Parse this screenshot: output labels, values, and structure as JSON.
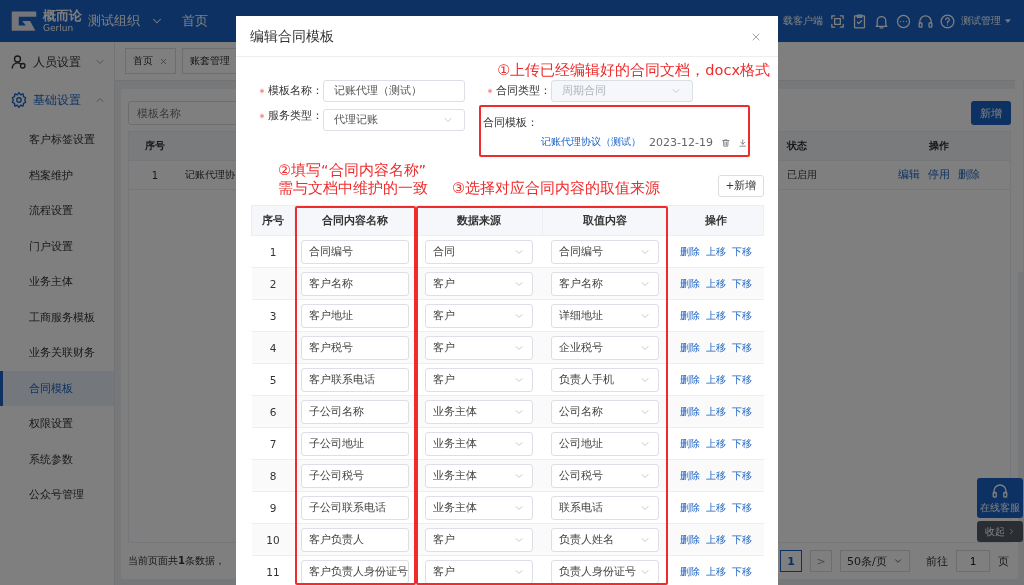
{
  "topbar": {
    "logo": {
      "name": "概而论",
      "sub": "Gerlun"
    },
    "org": "测试组织",
    "nav": [
      "首页"
    ],
    "download": "载客户端",
    "user": "测试管理"
  },
  "sidebar": [
    {
      "label": "人员设置",
      "expanded": false
    },
    {
      "label": "基础设置",
      "expanded": true,
      "children": [
        {
          "label": "客户标签设置",
          "selected": false
        },
        {
          "label": "档案维护",
          "selected": false
        },
        {
          "label": "流程设置",
          "selected": false
        },
        {
          "label": "门户设置",
          "selected": false
        },
        {
          "label": "业务主体",
          "selected": false
        },
        {
          "label": "工商服务模板",
          "selected": false
        },
        {
          "label": "业务关联财务",
          "selected": false
        },
        {
          "label": "合同模板",
          "selected": true
        },
        {
          "label": "权限设置",
          "selected": false
        },
        {
          "label": "系统参数",
          "selected": false
        },
        {
          "label": "公众号管理",
          "selected": false
        }
      ]
    }
  ],
  "tabs": [
    {
      "label": "首页",
      "closable": true
    },
    {
      "label": "账套管理",
      "closable": false
    }
  ],
  "search": {
    "placeholder": "模板名称"
  },
  "new_button": "新增",
  "table": {
    "columns": [
      "序号",
      "状态",
      "操作"
    ],
    "rows": [
      {
        "index": "1",
        "name": "记账代理协",
        "status": "已启用",
        "actions": [
          "编辑",
          "停用",
          "删除"
        ]
      }
    ]
  },
  "footer": "当前页面共**1**条数据，",
  "pagination": {
    "pages": [
      {
        "label": "1",
        "selected": true
      }
    ],
    "next": ">",
    "page_size": "50条/页",
    "goto": "前往",
    "goto_value": "1",
    "page_unit": "页"
  },
  "service": {
    "label": "在线客服",
    "collapse": "收起"
  },
  "modal": {
    "title": "编辑合同模板",
    "annotations": [
      {
        "kind": "upload",
        "text": "①上传已经编辑好的合同文档，docx格式"
      },
      {
        "kind": "name",
        "lines": [
          "②填写“合同内容名称”",
          "需与文档中维护的一致"
        ]
      },
      {
        "kind": "source",
        "text": "③选择对应合同内容的取值来源"
      }
    ],
    "fields": [
      {
        "kind": "input",
        "label": "模板名称：",
        "required": true,
        "value": "记账代理（测试）",
        "disabled": false
      },
      {
        "kind": "select",
        "label": "合同类型：",
        "required": true,
        "value": "周期合同",
        "disabled": true
      },
      {
        "kind": "select",
        "label": "服务类型：",
        "required": true,
        "value": "代理记账",
        "disabled": false
      },
      {
        "kind": "file",
        "label": "合同模板：",
        "required": false,
        "file": "记账代理协议（测试）",
        "date": "2023-12-19"
      }
    ],
    "add_button": "+新增",
    "columns": [
      "序号",
      "合同内容名称",
      "数据来源",
      "取值内容",
      "操作"
    ],
    "rows": [
      {
        "index": "1",
        "name": "合同编号",
        "source": "合同",
        "value": "合同编号",
        "actions": [
          "删除",
          "上移",
          "下移"
        ]
      },
      {
        "index": "2",
        "name": "客户名称",
        "source": "客户",
        "value": "客户名称",
        "actions": [
          "删除",
          "上移",
          "下移"
        ]
      },
      {
        "index": "3",
        "name": "客户地址",
        "source": "客户",
        "value": "详细地址",
        "actions": [
          "删除",
          "上移",
          "下移"
        ]
      },
      {
        "index": "4",
        "name": "客户税号",
        "source": "客户",
        "value": "企业税号",
        "actions": [
          "删除",
          "上移",
          "下移"
        ]
      },
      {
        "index": "5",
        "name": "客户联系电话",
        "source": "客户",
        "value": "负责人手机",
        "actions": [
          "删除",
          "上移",
          "下移"
        ]
      },
      {
        "index": "6",
        "name": "子公司名称",
        "source": "业务主体",
        "value": "公司名称",
        "actions": [
          "删除",
          "上移",
          "下移"
        ]
      },
      {
        "index": "7",
        "name": "子公司地址",
        "source": "业务主体",
        "value": "公司地址",
        "actions": [
          "删除",
          "上移",
          "下移"
        ]
      },
      {
        "index": "8",
        "name": "子公司税号",
        "source": "业务主体",
        "value": "公司税号",
        "actions": [
          "删除",
          "上移",
          "下移"
        ]
      },
      {
        "index": "9",
        "name": "子公司联系电话",
        "source": "业务主体",
        "value": "联系电话",
        "actions": [
          "删除",
          "上移",
          "下移"
        ]
      },
      {
        "index": "10",
        "name": "客户负责人",
        "source": "客户",
        "value": "负责人姓名",
        "actions": [
          "删除",
          "上移",
          "下移"
        ]
      },
      {
        "index": "11",
        "name": "客户负责人身份证号",
        "source": "客户",
        "value": "负责人身份证号",
        "actions": [
          "删除",
          "上移",
          "下移"
        ]
      }
    ]
  }
}
